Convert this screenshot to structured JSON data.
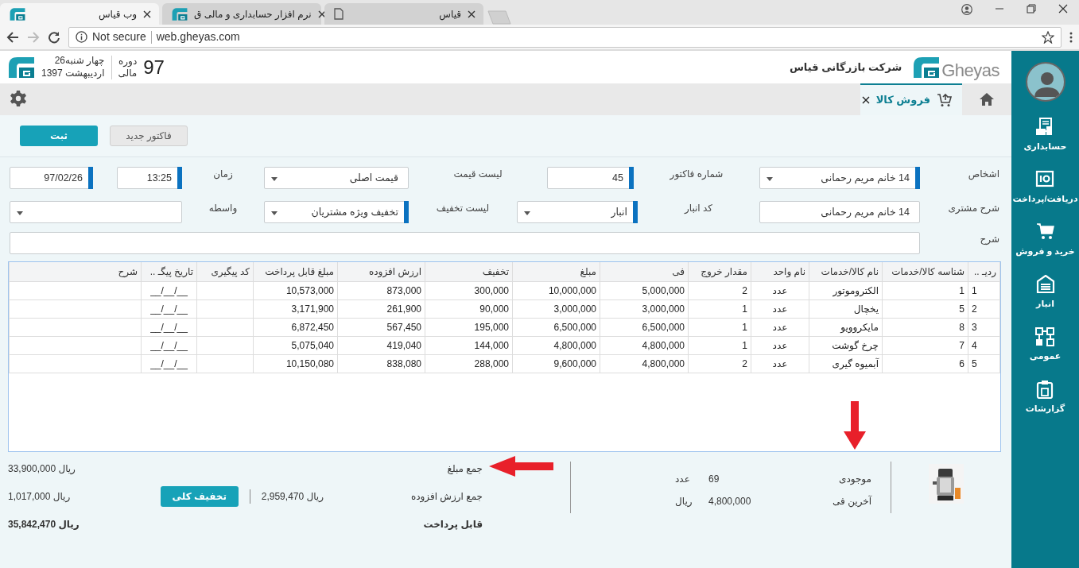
{
  "browser": {
    "tabs": [
      {
        "title": "قیاس",
        "selected": false,
        "kind": "page"
      },
      {
        "title": "نرم افزار حسابداری و مالی ق",
        "selected": false,
        "kind": "logo"
      },
      {
        "title": "وب قیاس",
        "selected": true,
        "kind": "logo"
      }
    ],
    "security": "Not secure",
    "url": "web.gheyas.com"
  },
  "header": {
    "logo_text": "Gheyas",
    "company": "شرکت بازرگانی قیاس",
    "period": "97",
    "period_label": [
      "دوره",
      "مالی"
    ],
    "weekday": "چهار شنبه26",
    "month_year": "اردیبهشت 1397"
  },
  "app_tabs": [
    {
      "label": "فروش کالا",
      "selected": true
    }
  ],
  "actions": [
    {
      "label": "فاکتور جدید",
      "kind": "secondary"
    },
    {
      "label": "ثبت",
      "kind": "primary"
    }
  ],
  "form_rows": [
    [
      {
        "label": "اشخاص",
        "kind": "select",
        "value": "14 خانم مریم رحمانی",
        "required": true
      },
      {
        "label": "شماره فاکتور",
        "kind": "input",
        "value": "45",
        "required": true
      },
      {
        "label": "لیست قیمت",
        "kind": "select",
        "value": "قیمت اصلی",
        "required": false
      },
      {
        "label": "زمان",
        "kind": "input",
        "value": "13:25",
        "required": true
      },
      {
        "kind": "input",
        "value": "97/02/26",
        "required": true
      }
    ],
    [
      {
        "label": "شرح مشتری",
        "kind": "input",
        "value": "14 خانم مریم رحمانی",
        "required": false
      },
      {
        "label": "کد انبار",
        "kind": "select",
        "value": "انبار",
        "required": true
      },
      {
        "label": "لیست تخفیف",
        "kind": "select",
        "value": "تخفیف ویژه مشتریان",
        "required": true
      },
      {
        "label": "واسطه",
        "kind": "select",
        "required": false
      }
    ],
    [
      {
        "label": "شرح",
        "kind": "input",
        "required": false
      }
    ]
  ],
  "table": {
    "columns": [
      "ردیـ ..",
      "شناسه کالا/خدمات",
      "نام کالا/خدمات",
      "نام واحد",
      "مقدار خروج",
      "فی",
      "مبلغ",
      "تخفیف",
      "ارزش افزوده",
      "مبلغ قابل پرداخت",
      "کد پیگیری",
      "تاریخ پیگـ ..",
      "شرح"
    ],
    "rows": [
      [
        "1",
        "1",
        "الکتروموتور",
        "عدد",
        "2",
        "5,000,000",
        "10,000,000",
        "300,000",
        "873,000",
        "10,573,000",
        "",
        "__/__/__",
        ""
      ],
      [
        "2",
        "5",
        "یخچال",
        "عدد",
        "1",
        "3,000,000",
        "3,000,000",
        "90,000",
        "261,900",
        "3,171,900",
        "",
        "__/__/__",
        ""
      ],
      [
        "3",
        "8",
        "مایکروویو",
        "عدد",
        "1",
        "6,500,000",
        "6,500,000",
        "195,000",
        "567,450",
        "6,872,450",
        "",
        "__/__/__",
        ""
      ],
      [
        "4",
        "7",
        "چرخ گوشت",
        "عدد",
        "1",
        "4,800,000",
        "4,800,000",
        "144,000",
        "419,040",
        "5,075,040",
        "",
        "__/__/__",
        ""
      ],
      [
        "5",
        "6",
        "آبمیوه گیری",
        "عدد",
        "2",
        "4,800,000",
        "9,600,000",
        "288,000",
        "838,080",
        "10,150,080",
        "",
        "__/__/__",
        ""
      ]
    ]
  },
  "stock": [
    {
      "label": "موجودی",
      "value": "69",
      "unit": "عدد"
    },
    {
      "label": "آخرین فی",
      "value": "4,800,000",
      "unit": "ریال"
    }
  ],
  "totals": [
    {
      "label": "جمع مبلغ",
      "value": "33,900,000 ریال",
      "bold": false
    },
    {
      "label": "جمع ارزش افزوده",
      "middle": "2,959,470 ریال",
      "button": "تخفیف کلی",
      "value": "1,017,000 ریال",
      "bold": false
    },
    {
      "label": "قابل پرداخت",
      "value": "35,842,470 ریال",
      "bold": true
    }
  ],
  "sidebar": {
    "items": [
      {
        "label": "حسابداری"
      },
      {
        "label": "دریافت/پرداخت"
      },
      {
        "label": "خرید و فروش"
      },
      {
        "label": "انبار"
      },
      {
        "label": "عمومی"
      },
      {
        "label": "گزارشات"
      }
    ]
  }
}
